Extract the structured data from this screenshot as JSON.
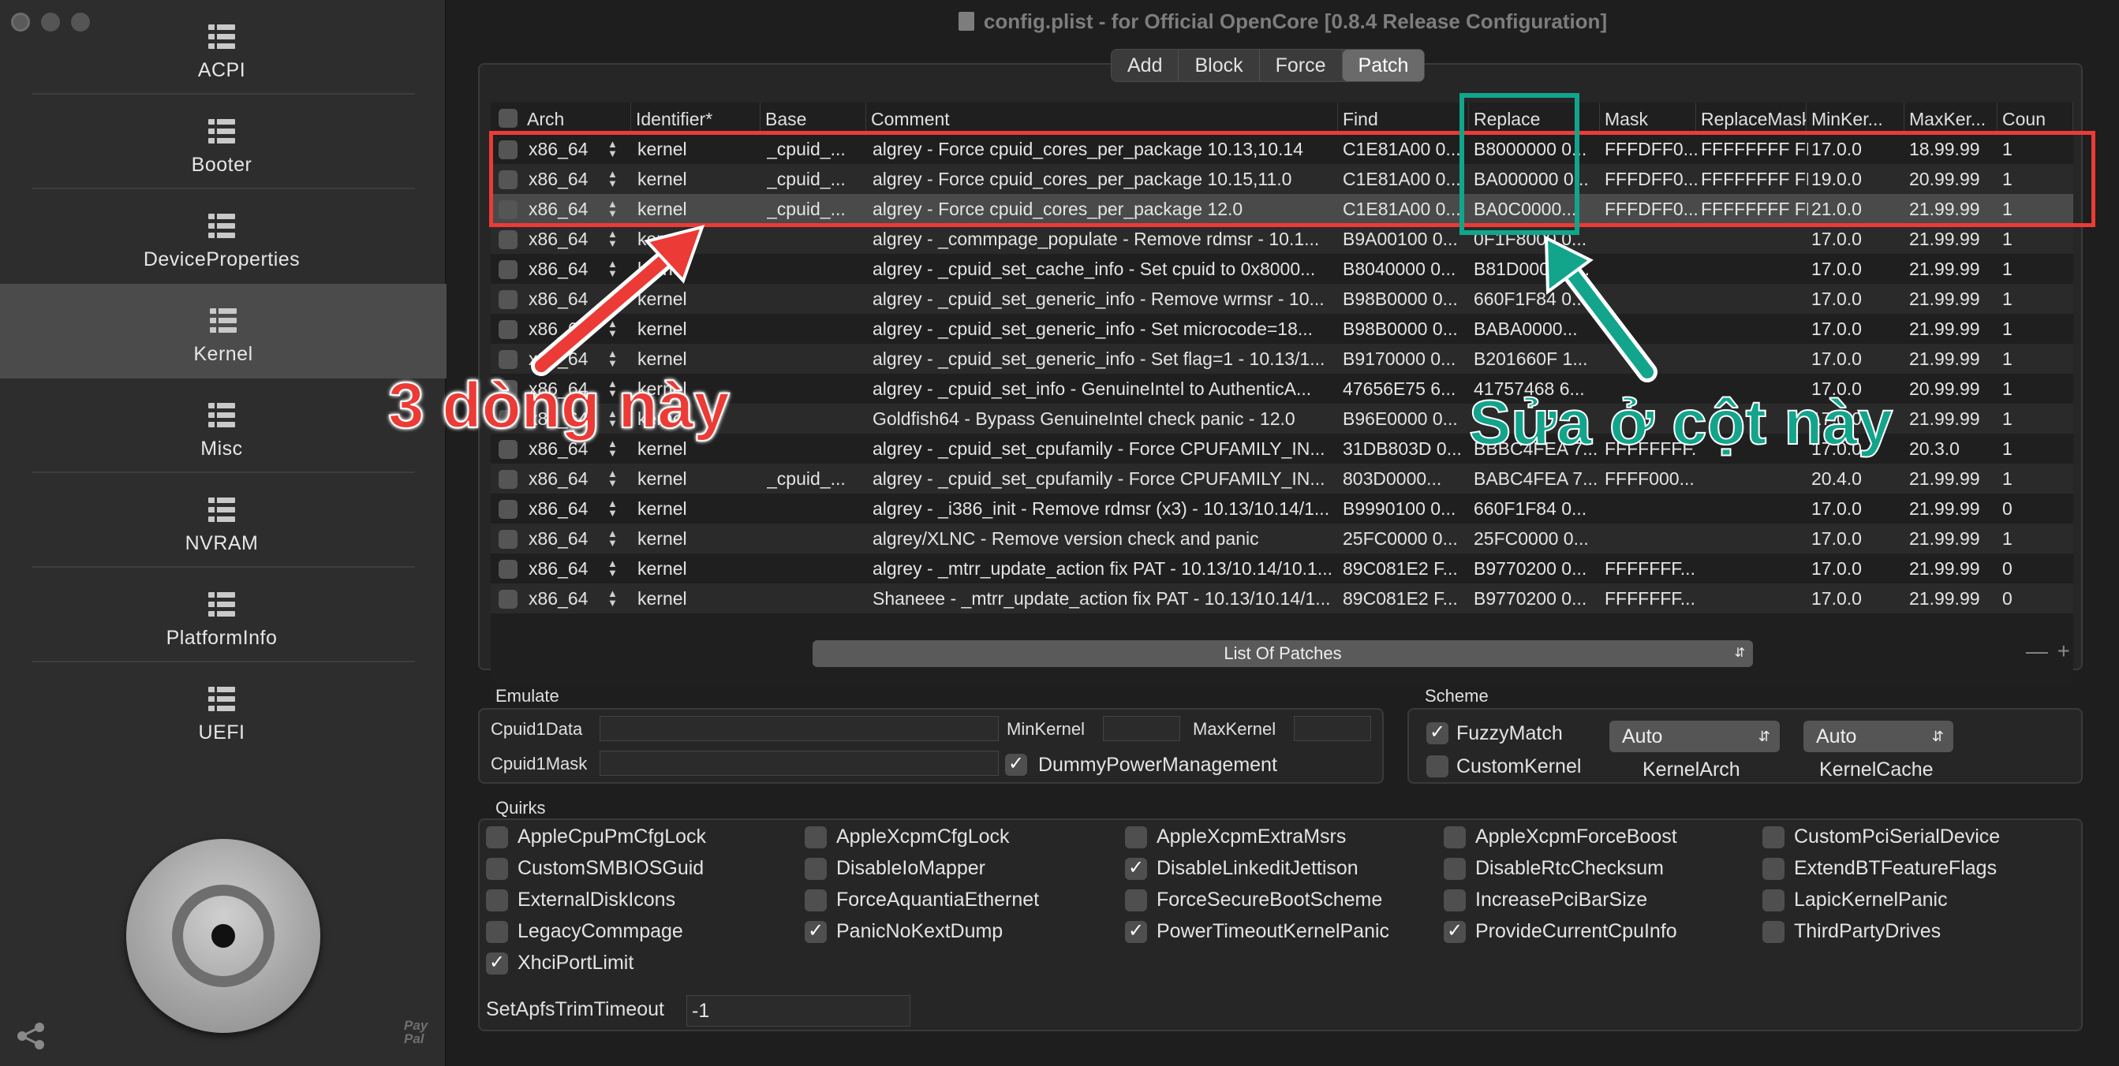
{
  "window": {
    "title": "config.plist - for Official OpenCore [0.8.4 Release Configuration]"
  },
  "sidebar": {
    "items": [
      {
        "label": "ACPI"
      },
      {
        "label": "Booter"
      },
      {
        "label": "DeviceProperties"
      },
      {
        "label": "Kernel",
        "selected": true
      },
      {
        "label": "Misc"
      },
      {
        "label": "NVRAM"
      },
      {
        "label": "PlatformInfo"
      },
      {
        "label": "UEFI"
      }
    ],
    "paypal": "Pay Pal"
  },
  "tabs": [
    {
      "label": "Add"
    },
    {
      "label": "Block"
    },
    {
      "label": "Force"
    },
    {
      "label": "Patch",
      "active": true
    }
  ],
  "patch_table": {
    "columns": [
      "Arch",
      "Identifier*",
      "Base",
      "Comment",
      "Find",
      "Replace",
      "Mask",
      "ReplaceMask",
      "MinKer...",
      "MaxKer...",
      "Coun"
    ],
    "rows": [
      [
        "x86_64",
        "kernel",
        "_cpuid_...",
        "algrey - Force cpuid_cores_per_package 10.13,10.14",
        "C1E81A00 0...",
        "B8000000 0...",
        "FFFDFF0...",
        "FFFFFFFF FF...",
        "17.0.0",
        "18.99.99",
        "1"
      ],
      [
        "x86_64",
        "kernel",
        "_cpuid_...",
        "algrey - Force cpuid_cores_per_package 10.15,11.0",
        "C1E81A00 0...",
        "BA000000 0...",
        "FFFDFF0...",
        "FFFFFFFF FF...",
        "19.0.0",
        "20.99.99",
        "1"
      ],
      [
        "x86_64",
        "kernel",
        "_cpuid_...",
        "algrey - Force cpuid_cores_per_package 12.0",
        "C1E81A00 0...",
        "BA0C0000...",
        "FFFDFF0...",
        "FFFFFFFF FF...",
        "21.0.0",
        "21.99.99",
        "1"
      ],
      [
        "x86_64",
        "kernel",
        "",
        "algrey - _commpage_populate - Remove rdmsr - 10.1...",
        "B9A00100 0...",
        "0F1F8000 0...",
        "",
        "",
        "17.0.0",
        "21.99.99",
        "1"
      ],
      [
        "x86_64",
        "kernel",
        "",
        "algrey - _cpuid_set_cache_info - Set cpuid to 0x8000...",
        "B8040000 0...",
        "B81D0000 8...",
        "",
        "",
        "17.0.0",
        "21.99.99",
        "1"
      ],
      [
        "x86_64",
        "kernel",
        "",
        "algrey - _cpuid_set_generic_info - Remove wrmsr - 10...",
        "B98B0000 0...",
        "660F1F84 0...",
        "",
        "",
        "17.0.0",
        "21.99.99",
        "1"
      ],
      [
        "x86_64",
        "kernel",
        "",
        "algrey - _cpuid_set_generic_info - Set microcode=18...",
        "B98B0000 0...",
        "BABA0000...",
        "",
        "",
        "17.0.0",
        "21.99.99",
        "1"
      ],
      [
        "x86_64",
        "kernel",
        "",
        "algrey - _cpuid_set_generic_info - Set flag=1 - 10.13/1...",
        "B9170000 0...",
        "B201660F 1...",
        "",
        "",
        "17.0.0",
        "21.99.99",
        "1"
      ],
      [
        "x86_64",
        "kernel",
        "",
        "algrey - _cpuid_set_info - GenuineIntel to AuthenticA...",
        "47656E75 6...",
        "41757468 6...",
        "",
        "",
        "17.0.0",
        "20.99.99",
        "1"
      ],
      [
        "x86_64",
        "kernel",
        "",
        "Goldfish64 - Bypass GenuineIntel check panic - 12.0",
        "B96E0000 0...",
        "",
        "",
        "",
        "17.0.0",
        "21.99.99",
        "1"
      ],
      [
        "x86_64",
        "kernel",
        "",
        "algrey - _cpuid_set_cpufamily - Force CPUFAMILY_IN...",
        "31DB803D 0...",
        "BBBC4FEA 7...",
        "FFFFFFFF...",
        "",
        "17.0.0",
        "20.3.0",
        "1"
      ],
      [
        "x86_64",
        "kernel",
        "_cpuid_...",
        "algrey - _cpuid_set_cpufamily - Force CPUFAMILY_IN...",
        "803D0000...",
        "BABC4FEA 7...",
        "FFFF000...",
        "",
        "20.4.0",
        "21.99.99",
        "1"
      ],
      [
        "x86_64",
        "kernel",
        "",
        "algrey - _i386_init - Remove rdmsr (x3) - 10.13/10.14/1...",
        "B9990100 0...",
        "660F1F84 0...",
        "",
        "",
        "17.0.0",
        "21.99.99",
        "0"
      ],
      [
        "x86_64",
        "kernel",
        "",
        "algrey/XLNC - Remove version check and panic",
        "25FC0000 0...",
        "25FC0000 0...",
        "",
        "",
        "17.0.0",
        "21.99.99",
        "1"
      ],
      [
        "x86_64",
        "kernel",
        "",
        "algrey - _mtrr_update_action fix PAT - 10.13/10.14/10.1...",
        "89C081E2 F...",
        "B9770200 0...",
        "FFFFFFF...",
        "",
        "17.0.0",
        "21.99.99",
        "0"
      ],
      [
        "x86_64",
        "kernel",
        "",
        "Shaneee - _mtrr_update_action fix PAT - 10.13/10.14/1...",
        "89C081E2 F...",
        "B9770200 0...",
        "FFFFFFF...",
        "",
        "17.0.0",
        "21.99.99",
        "0"
      ]
    ],
    "list_select": "List Of Patches",
    "add_remove": "— +"
  },
  "emulate": {
    "title": "Emulate",
    "cpuid1data_label": "Cpuid1Data",
    "cpuid1mask_label": "Cpuid1Mask",
    "minkernel_label": "MinKernel",
    "maxkernel_label": "MaxKernel",
    "dummy_label": "DummyPowerManagement",
    "dummy_checked": true
  },
  "scheme": {
    "title": "Scheme",
    "fuzzy_label": "FuzzyMatch",
    "fuzzy_checked": true,
    "custom_label": "CustomKernel",
    "custom_checked": false,
    "arch_value": "Auto",
    "cache_value": "Auto",
    "arch_label": "KernelArch",
    "cache_label": "KernelCache"
  },
  "quirks": {
    "title": "Quirks",
    "items": [
      {
        "label": "AppleCpuPmCfgLock",
        "checked": false
      },
      {
        "label": "AppleXcpmCfgLock",
        "checked": false
      },
      {
        "label": "AppleXcpmExtraMsrs",
        "checked": false
      },
      {
        "label": "AppleXcpmForceBoost",
        "checked": false
      },
      {
        "label": "CustomPciSerialDevice",
        "checked": false
      },
      {
        "label": "CustomSMBIOSGuid",
        "checked": false
      },
      {
        "label": "DisableIoMapper",
        "checked": false
      },
      {
        "label": "DisableLinkeditJettison",
        "checked": true
      },
      {
        "label": "DisableRtcChecksum",
        "checked": false
      },
      {
        "label": "ExtendBTFeatureFlags",
        "checked": false
      },
      {
        "label": "ExternalDiskIcons",
        "checked": false
      },
      {
        "label": "ForceAquantiaEthernet",
        "checked": false
      },
      {
        "label": "ForceSecureBootScheme",
        "checked": false
      },
      {
        "label": "IncreasePciBarSize",
        "checked": false
      },
      {
        "label": "LapicKernelPanic",
        "checked": false
      },
      {
        "label": "LegacyCommpage",
        "checked": false
      },
      {
        "label": "PanicNoKextDump",
        "checked": true
      },
      {
        "label": "PowerTimeoutKernelPanic",
        "checked": true
      },
      {
        "label": "ProvideCurrentCpuInfo",
        "checked": true
      },
      {
        "label": "ThirdPartyDrives",
        "checked": false
      },
      {
        "label": "XhciPortLimit",
        "checked": true
      }
    ],
    "apfs_label": "SetApfsTrimTimeout",
    "apfs_value": "-1"
  },
  "annotations": {
    "red_text": "3 dòng này",
    "teal_text": "Sửa ở cột này",
    "red_color": "#ec3b36",
    "teal_color": "#12a58c"
  }
}
